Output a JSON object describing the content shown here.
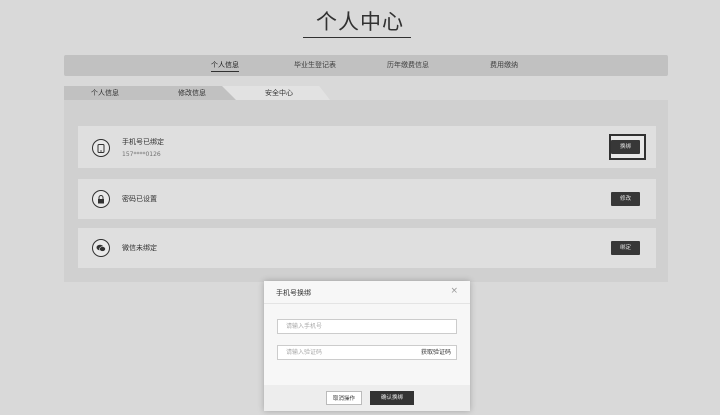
{
  "page": {
    "title": "个人中心"
  },
  "main_tabs": [
    {
      "label": "个人信息",
      "active": true
    },
    {
      "label": "毕业生登记表",
      "active": false
    },
    {
      "label": "历年缴费信息",
      "active": false
    },
    {
      "label": "费用缴纳",
      "active": false
    }
  ],
  "sub_tabs": [
    {
      "label": "个人信息"
    },
    {
      "label": "修改信息"
    },
    {
      "label": "安全中心",
      "active": true
    }
  ],
  "security": {
    "phone": {
      "title": "手机号已绑定",
      "value": "157****0126",
      "button": "换绑",
      "icon": "phone-icon"
    },
    "password": {
      "title": "密码已设置",
      "button": "修改",
      "icon": "lock-icon"
    },
    "wechat": {
      "title": "微信未绑定",
      "button": "绑定",
      "icon": "wechat-icon"
    }
  },
  "modal": {
    "title": "手机号换绑",
    "close": "×",
    "phone_placeholder": "请输入手机号",
    "code_placeholder": "请输入验证码",
    "get_code": "获取验证码",
    "cancel": "取消操作",
    "confirm": "确认换绑"
  },
  "colors": {
    "accent": "#333333",
    "background": "#e2e2e2"
  }
}
